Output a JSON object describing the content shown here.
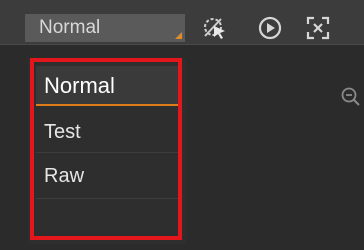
{
  "toolbar": {
    "mode_select": {
      "value": "Normal",
      "caret_color": "#e58a1f"
    },
    "icons": [
      "cursor-crossed-icon",
      "play-icon",
      "fullscreen-icon"
    ]
  },
  "zoom": {
    "icon": "zoom-out-icon"
  },
  "dropdown": {
    "options": [
      {
        "label": "Normal",
        "selected": true
      },
      {
        "label": "Test",
        "selected": false
      },
      {
        "label": "Raw",
        "selected": false
      }
    ],
    "accent_color": "#e07b1a"
  },
  "annotation": {
    "highlight_color": "#e3161b"
  }
}
